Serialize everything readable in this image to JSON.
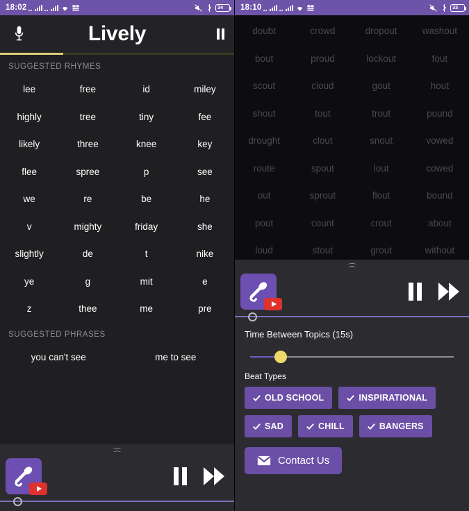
{
  "left": {
    "statusbar": {
      "clock": "18:02",
      "battery_level": "34",
      "icons": [
        "signal-bars-icon",
        "signal-bars-icon",
        "wifi-icon",
        "network-icon",
        "mute-icon",
        "bluetooth-icon",
        "battery-icon"
      ]
    },
    "appbar": {
      "title": "Lively",
      "mic_icon": "microphone-icon",
      "pause_icon": "pause-icon"
    },
    "progress_percent": 27,
    "rhymes_label": "SUGGESTED RHYMES",
    "rhymes": [
      "lee",
      "free",
      "id",
      "miley",
      "highly",
      "tree",
      "tiny",
      "fee",
      "likely",
      "three",
      "knee",
      "key",
      "flee",
      "spree",
      "p",
      "see",
      "we",
      "re",
      "be",
      "he",
      "v",
      "mighty",
      "friday",
      "she",
      "slightly",
      "de",
      "t",
      "nike",
      "ye",
      "g",
      "mit",
      "e",
      "z",
      "thee",
      "me",
      "pre"
    ],
    "phrases_label": "SUGGESTED PHRASES",
    "phrases": [
      "you can't see",
      "me to see"
    ],
    "player": {
      "expand_icon": "chevron-up-icon",
      "app_icon": "microphone-app-icon",
      "badge_icon": "youtube-play-badge-icon",
      "pause_icon": "pause-icon",
      "forward_icon": "fast-forward-icon",
      "seek_percent": 4
    }
  },
  "right": {
    "statusbar": {
      "clock": "18:10",
      "battery_level": "33",
      "icons": [
        "signal-bars-icon",
        "signal-bars-icon",
        "wifi-icon",
        "network-icon",
        "mute-icon",
        "bluetooth-icon",
        "battery-icon"
      ]
    },
    "rhymes": [
      "doubt",
      "crowd",
      "dropout",
      "washout",
      "bout",
      "proud",
      "lockout",
      "fout",
      "scout",
      "cloud",
      "gout",
      "hout",
      "shout",
      "tout",
      "trout",
      "pound",
      "drought",
      "clout",
      "snout",
      "vowed",
      "route",
      "spout",
      "lout",
      "cowed",
      "out",
      "sprout",
      "flout",
      "bound",
      "pout",
      "count",
      "crout",
      "about",
      "loud",
      "stout",
      "grout",
      "without"
    ],
    "player": {
      "expand_icon": "chevron-up-icon",
      "app_icon": "microphone-app-icon",
      "badge_icon": "youtube-play-badge-icon",
      "pause_icon": "pause-icon",
      "forward_icon": "fast-forward-icon",
      "seek_percent": 4
    },
    "settings": {
      "topic_timer_label": "Time Between Topics (15s)",
      "topic_timer_percent": 15,
      "beat_types_label": "Beat Types",
      "beat_types": [
        {
          "label": "OLD SCHOOL",
          "checked": true
        },
        {
          "label": "INSPIRATIONAL",
          "checked": true
        },
        {
          "label": "SAD",
          "checked": true
        },
        {
          "label": "CHILL",
          "checked": true
        },
        {
          "label": "BANGERS",
          "checked": true
        }
      ],
      "contact_label": "Contact Us",
      "contact_icon": "envelope-icon"
    }
  },
  "colors": {
    "status_purple": "#6d54a8",
    "accent_purple": "#6b4fa6",
    "slider_yellow": "#ecd96a",
    "progress_yellow": "#d9cf78",
    "youtube_red": "#e0322c"
  }
}
